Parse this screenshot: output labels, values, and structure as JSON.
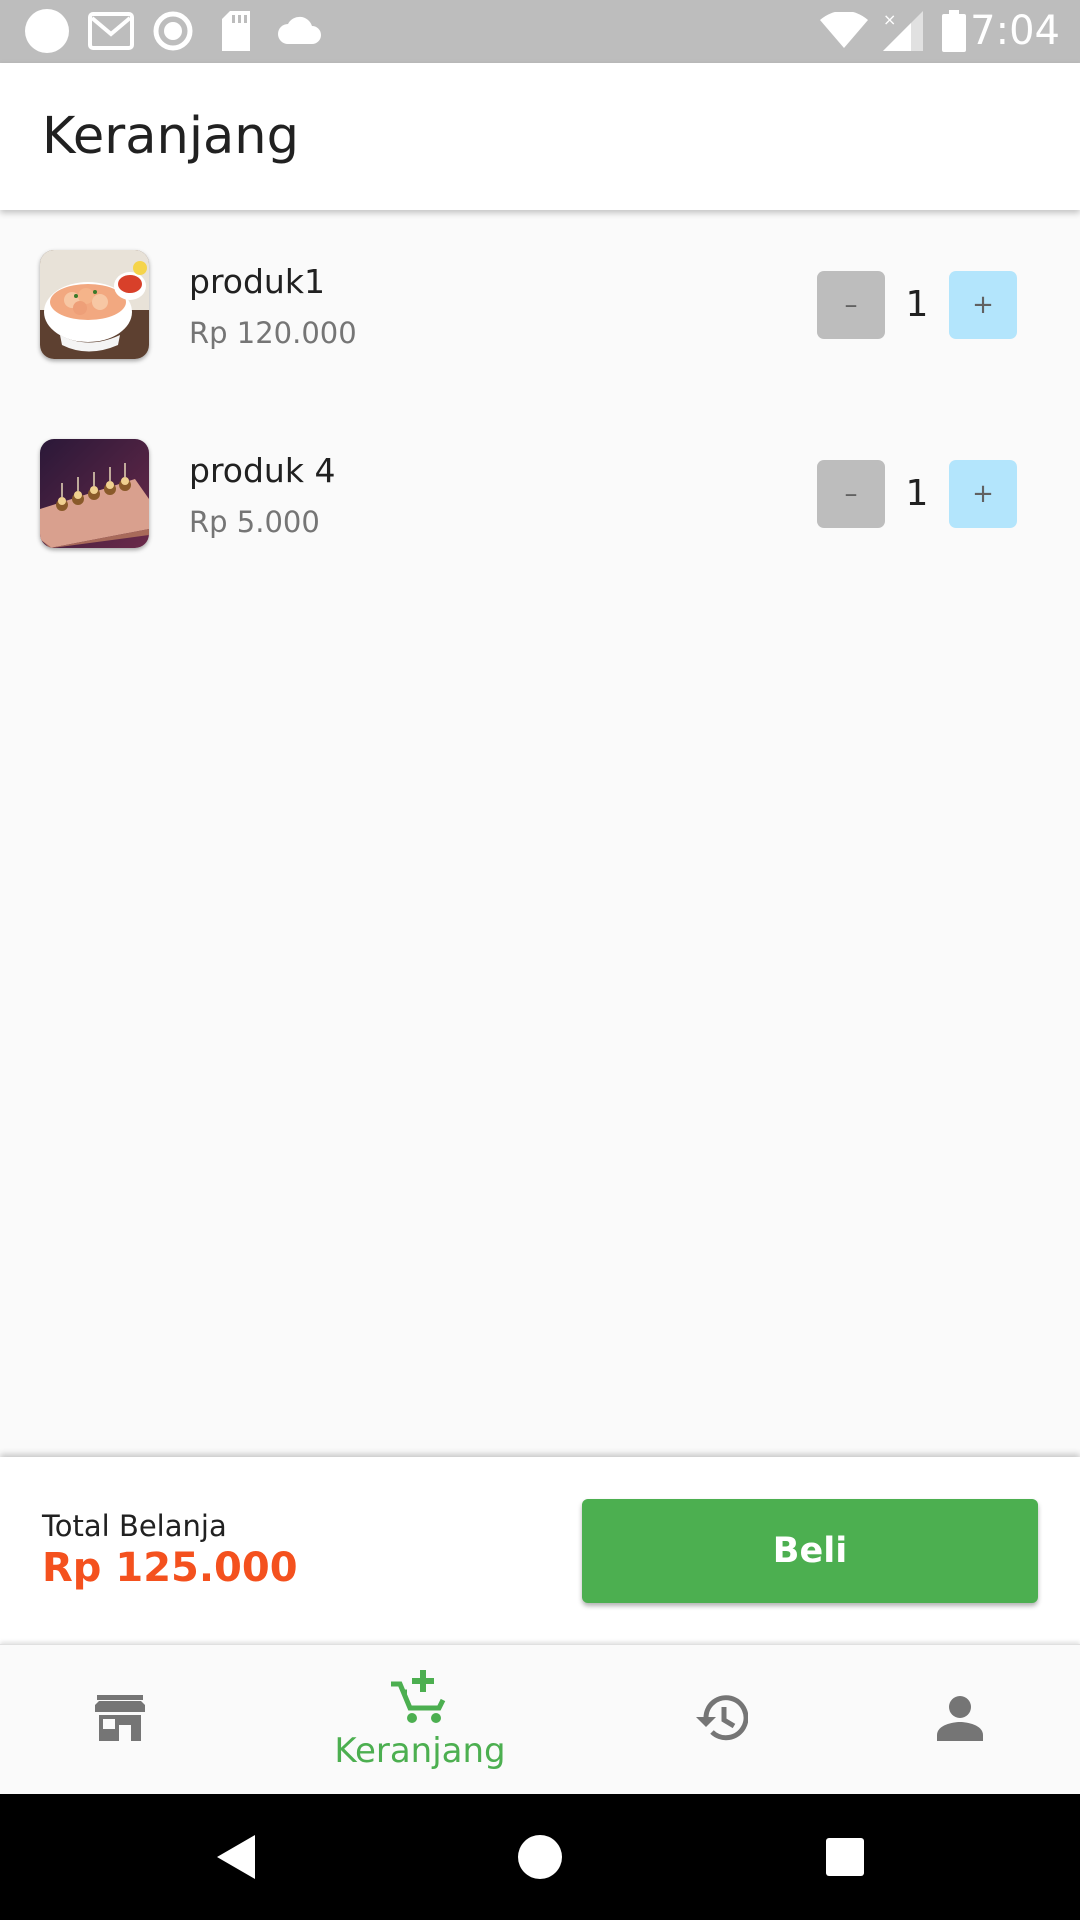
{
  "status_bar": {
    "time": "7:04",
    "left_icons": [
      "circle-icon",
      "gmail-icon",
      "record-icon",
      "sd-card-icon",
      "cloud-icon"
    ],
    "right_icons": [
      "wifi-icon",
      "signal-icon",
      "battery-icon"
    ]
  },
  "app_bar": {
    "title": "Keranjang"
  },
  "cart": {
    "items": [
      {
        "name": "produk1",
        "price": "Rp 120.000",
        "quantity": "1",
        "minus_label": "–",
        "plus_label": "+",
        "image": "shrimp-dish"
      },
      {
        "name": "produk 4",
        "price": "Rp 5.000",
        "quantity": "1",
        "minus_label": "–",
        "plus_label": "+",
        "image": "mini-burgers"
      }
    ]
  },
  "checkout": {
    "total_label": "Total Belanja",
    "total_value": "Rp 125.000",
    "buy_label": "Beli"
  },
  "bottom_nav": {
    "items": [
      {
        "icon": "store-icon",
        "label": ""
      },
      {
        "icon": "cart-add-icon",
        "label": "Keranjang",
        "active": true
      },
      {
        "icon": "history-icon",
        "label": ""
      },
      {
        "icon": "person-icon",
        "label": ""
      }
    ]
  },
  "colors": {
    "accent": "#4caf50",
    "total_price": "#f4511e",
    "minus_button": "#bdbdbd",
    "plus_button": "#b3e5fc",
    "nav_inactive": "#757575"
  }
}
